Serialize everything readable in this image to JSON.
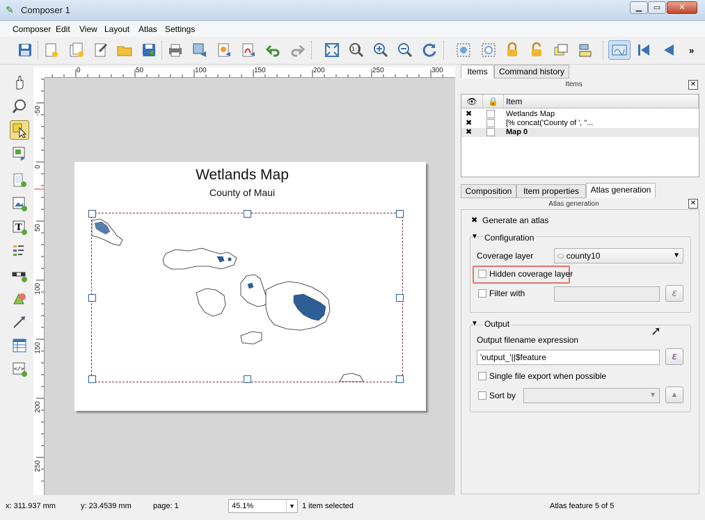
{
  "window": {
    "title": "Composer 1"
  },
  "menu": [
    {
      "label": "Composer",
      "u": "C"
    },
    {
      "label": "Edit",
      "u": "E"
    },
    {
      "label": "View",
      "u": "V"
    },
    {
      "label": "Layout",
      "u": "L"
    },
    {
      "label": "Atlas",
      "u": "A"
    },
    {
      "label": "Settings",
      "u": "S"
    }
  ],
  "toolbar": {
    "icons": [
      "save-icon",
      "new-composer-icon",
      "duplicate-composer-icon",
      "composer-manager-icon",
      "open-folder-icon",
      "save-template-icon",
      "print-icon",
      "export-image-icon",
      "export-svg-icon",
      "export-pdf-icon",
      "undo-icon",
      "redo-icon",
      "zoom-full-icon",
      "zoom-actual-icon",
      "zoom-in-icon",
      "zoom-out-icon",
      "refresh-icon",
      "group-icon",
      "ungroup-icon",
      "lock-icon",
      "unlock-icon",
      "raise-icon",
      "align-icon",
      "atlas-preview-icon",
      "first-feature-icon",
      "prev-feature-icon"
    ],
    "overflow": "»"
  },
  "ruler": {
    "top_labels": [
      "0",
      "50",
      "100",
      "150",
      "200",
      "250",
      "300"
    ],
    "left_labels": [
      "-50",
      "0",
      "50",
      "100",
      "150",
      "200",
      "250"
    ]
  },
  "map": {
    "title": "Wetlands Map",
    "subtitle": "County of Maui"
  },
  "panel": {
    "tabs": [
      "Items",
      "Command history"
    ],
    "items_dock_title": "Items",
    "items_header": "Item",
    "items": [
      {
        "name": "Wetlands Map",
        "bold": false
      },
      {
        "name": "[% concat('County of ', \"...",
        "bold": false
      },
      {
        "name": "Map 0",
        "bold": true
      }
    ],
    "lower_tabs": [
      "Composition",
      "Item properties",
      "Atlas generation"
    ],
    "atlas_dock_title": "Atlas generation",
    "generate_label": "Generate an atlas",
    "config_title": "Configuration",
    "coverage_label": "Coverage layer",
    "coverage_value": "county10",
    "hidden_coverage_label": "Hidden coverage layer",
    "filter_label": "Filter with",
    "expression_button": "ε",
    "output_title": "Output",
    "output_expr_label": "Output filename expression",
    "output_expr_value": "'output_'||$feature",
    "single_file_label": "Single file export when possible",
    "sort_label": "Sort by"
  },
  "status": {
    "x": "x: 311.937 mm",
    "y": "y: 23.4539 mm",
    "page": "page: 1",
    "zoom": "45.1%",
    "selected": "1 item selected",
    "atlas_feature": "Atlas feature 5 of 5"
  },
  "colors": {
    "highlight_box": "#e57373",
    "wetland_fill": "#2e5e96",
    "accent": "#3a72b5"
  }
}
